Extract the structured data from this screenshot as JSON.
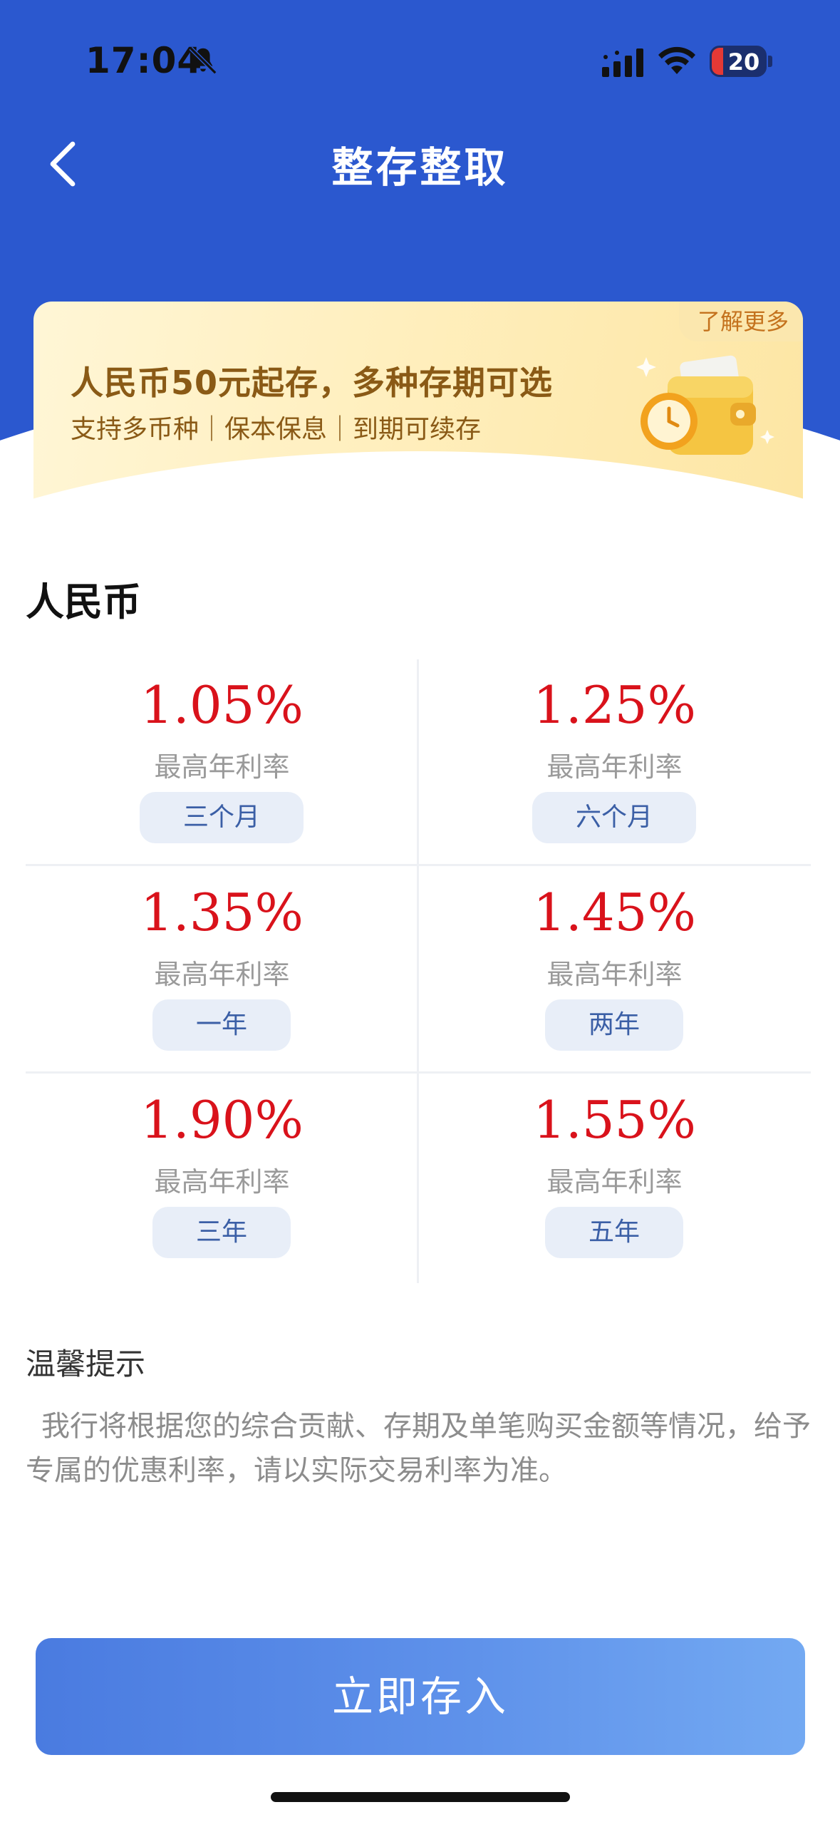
{
  "status_bar": {
    "time": "17:04",
    "battery_level": "20",
    "icons": [
      "bell-off-icon",
      "signal-icon",
      "wifi-icon",
      "battery-icon"
    ]
  },
  "nav": {
    "title": "整存整取",
    "back_icon": "chevron-left-icon"
  },
  "banner": {
    "headline": "人民币50元起存，多种存期可选",
    "subtitle": "支持多币种｜保本保息｜到期可续存",
    "learn_more": "了解更多",
    "icon": "wallet-clock-icon"
  },
  "currency_section": {
    "title": "人民币",
    "rates": [
      {
        "rate": "1.05%",
        "label": "最高年利率",
        "term": "三个月"
      },
      {
        "rate": "1.25%",
        "label": "最高年利率",
        "term": "六个月"
      },
      {
        "rate": "1.35%",
        "label": "最高年利率",
        "term": "一年"
      },
      {
        "rate": "1.45%",
        "label": "最高年利率",
        "term": "两年"
      },
      {
        "rate": "1.90%",
        "label": "最高年利率",
        "term": "三年"
      },
      {
        "rate": "1.55%",
        "label": "最高年利率",
        "term": "五年"
      }
    ]
  },
  "tips": {
    "title": "温馨提示",
    "text": "我行将根据您的综合贡献、存期及单笔购买金额等情况，给予专属的优惠利率，请以实际交易利率为准。"
  },
  "action": {
    "deposit_label": "立即存入"
  },
  "colors": {
    "header_blue": "#2b58cf",
    "rate_red": "#d9121b",
    "pill_bg": "#e8eef8",
    "button_start": "#4a7be0",
    "button_end": "#73a9f2"
  }
}
